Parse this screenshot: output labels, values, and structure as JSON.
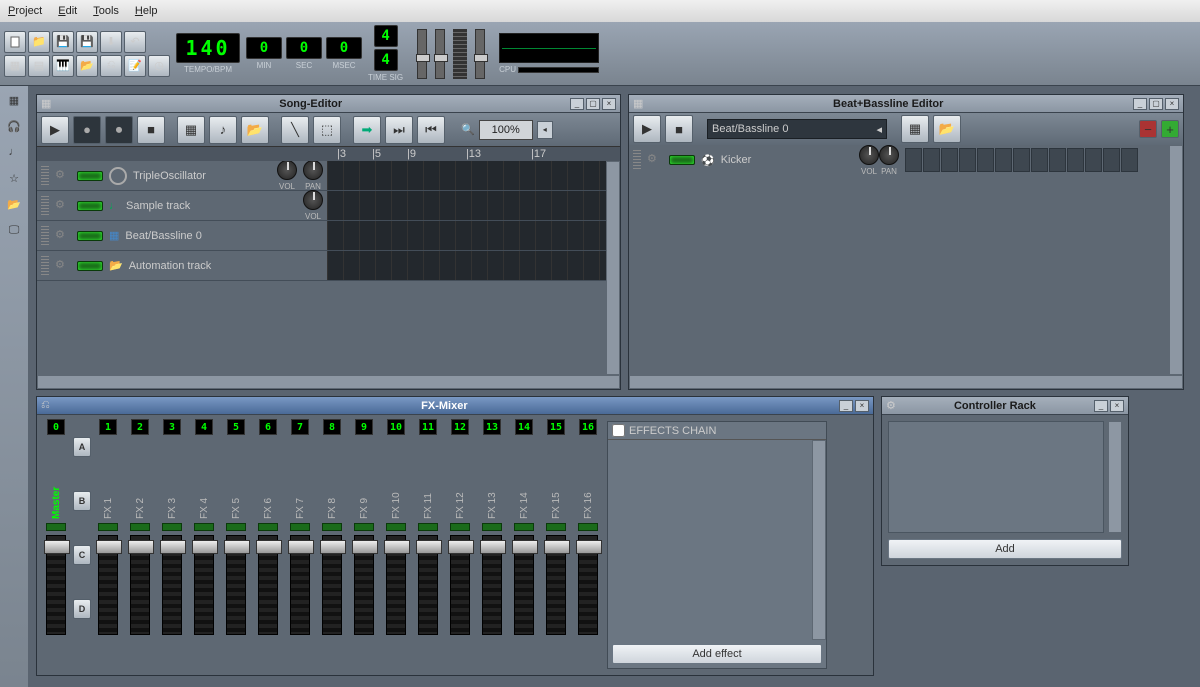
{
  "menu": [
    "Project",
    "Edit",
    "Tools",
    "Help"
  ],
  "tempo": {
    "bpm": "140",
    "label": "TEMPO/BPM"
  },
  "time": {
    "min": "0",
    "sec": "0",
    "msec": "0",
    "minl": "MIN",
    "secl": "SEC",
    "msecl": "MSEC"
  },
  "timesig": {
    "num": "4",
    "den": "4",
    "label": "TIME SIG"
  },
  "cpu_label": "CPU",
  "song_editor": {
    "title": "Song-Editor",
    "zoom": "100%",
    "ruler": [
      "|3",
      "|",
      "|5",
      "|",
      "|",
      "|",
      "|9",
      "|",
      "|",
      "|",
      "|13",
      "|",
      "|",
      "|",
      "|17",
      "|"
    ],
    "vol": "VOL",
    "pan": "PAN",
    "tracks": [
      {
        "name": "TripleOscillator",
        "type": "instrument"
      },
      {
        "name": "Sample track",
        "type": "sample"
      },
      {
        "name": "Beat/Bassline 0",
        "type": "bb"
      },
      {
        "name": "Automation track",
        "type": "automation"
      }
    ]
  },
  "bb_editor": {
    "title": "Beat+Bassline Editor",
    "pattern": "Beat/Bassline 0",
    "vol": "VOL",
    "pan": "PAN",
    "tracks": [
      {
        "name": "Kicker"
      }
    ]
  },
  "fx_mixer": {
    "title": "FX-Mixer",
    "sends": [
      "A",
      "B",
      "C",
      "D"
    ],
    "master": {
      "num": "0",
      "name": "Master"
    },
    "channels": [
      {
        "num": "1",
        "name": "FX 1"
      },
      {
        "num": "2",
        "name": "FX 2"
      },
      {
        "num": "3",
        "name": "FX 3"
      },
      {
        "num": "4",
        "name": "FX 4"
      },
      {
        "num": "5",
        "name": "FX 5"
      },
      {
        "num": "6",
        "name": "FX 6"
      },
      {
        "num": "7",
        "name": "FX 7"
      },
      {
        "num": "8",
        "name": "FX 8"
      },
      {
        "num": "9",
        "name": "FX 9"
      },
      {
        "num": "10",
        "name": "FX 10"
      },
      {
        "num": "11",
        "name": "FX 11"
      },
      {
        "num": "12",
        "name": "FX 12"
      },
      {
        "num": "13",
        "name": "FX 13"
      },
      {
        "num": "14",
        "name": "FX 14"
      },
      {
        "num": "15",
        "name": "FX 15"
      },
      {
        "num": "16",
        "name": "FX 16"
      }
    ],
    "effects_chain": "EFFECTS CHAIN",
    "add_effect": "Add effect"
  },
  "controller_rack": {
    "title": "Controller Rack",
    "add": "Add"
  }
}
